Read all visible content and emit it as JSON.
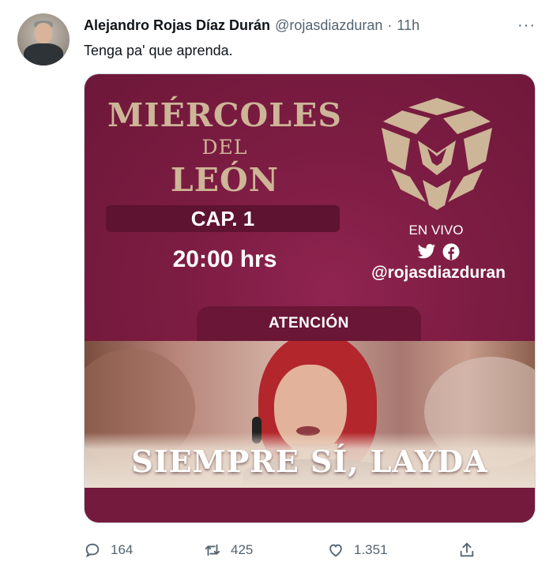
{
  "author": {
    "display_name": "Alejandro Rojas Díaz Durán",
    "handle": "@rojasdiazduran",
    "separator": "·",
    "time": "11h"
  },
  "tweet": {
    "text": "Tenga pa' que aprenda."
  },
  "more_menu_label": "···",
  "media": {
    "title_line1": "MIÉRCOLES",
    "title_line2": "DEL",
    "title_line3": "LEÓN",
    "chapter": "CAP. 1",
    "time": "20:00 hrs",
    "live_label": "EN VIVO",
    "handle": "@rojasdiazduran",
    "attention_label": "ATENCIÓN",
    "headline": "SIEMPRE SÍ, LAYDA",
    "colors": {
      "maroon": "#7c1c42",
      "gold": "#cdb597"
    }
  },
  "actions": {
    "reply_count": "164",
    "retweet_count": "425",
    "like_count": "1.351"
  }
}
